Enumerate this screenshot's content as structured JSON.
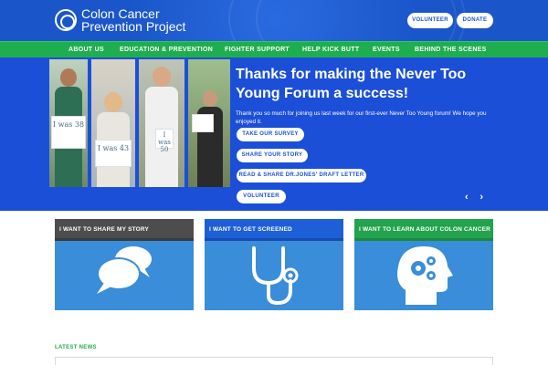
{
  "header": {
    "logo_line1": "Colon Cancer",
    "logo_line2": "Prevention Project",
    "volunteer_label": "VOLUNTEER",
    "donate_label": "DONATE"
  },
  "nav": {
    "items": [
      {
        "label": "ABOUT US"
      },
      {
        "label": "EDUCATION & PREVENTION"
      },
      {
        "label": "FIGHTER SUPPORT"
      },
      {
        "label": "HELP KICK BUTT"
      },
      {
        "label": "EVENTS"
      },
      {
        "label": "BEHIND THE SCENES"
      }
    ]
  },
  "hero": {
    "title": "Thanks for making the Never Too Young Forum a success!",
    "text": "Thank you so much for joining us last week for our first-ever Never Too Young forum! We hope you enjoyed it.",
    "buttons": [
      {
        "label": "TAKE OUR SURVEY"
      },
      {
        "label": "SHARE YOUR STORY"
      },
      {
        "label": "READ & SHARE DR.JONES' DRAFT LETTER"
      },
      {
        "label": "VOLUNTEER"
      }
    ],
    "signs": [
      "I was 38",
      "I was 43",
      "I was 50",
      ""
    ],
    "prev_arrow": "‹",
    "next_arrow": "›"
  },
  "cards": [
    {
      "title": "I WANT TO SHARE MY STORY",
      "icon": "chat-bubbles-icon",
      "head_color": "#4d4d4d"
    },
    {
      "title": "I WANT TO GET SCREENED",
      "icon": "stethoscope-icon",
      "head_color": "#1d5fd6"
    },
    {
      "title": "I WANT TO LEARN ABOUT COLON CANCER",
      "icon": "head-gears-icon",
      "head_color": "#22a34c"
    }
  ],
  "news": {
    "label": "LATEST NEWS"
  },
  "colors": {
    "brand_blue": "#1a56c9",
    "nav_green": "#1fae4f",
    "card_blue": "#3a8dd8"
  }
}
